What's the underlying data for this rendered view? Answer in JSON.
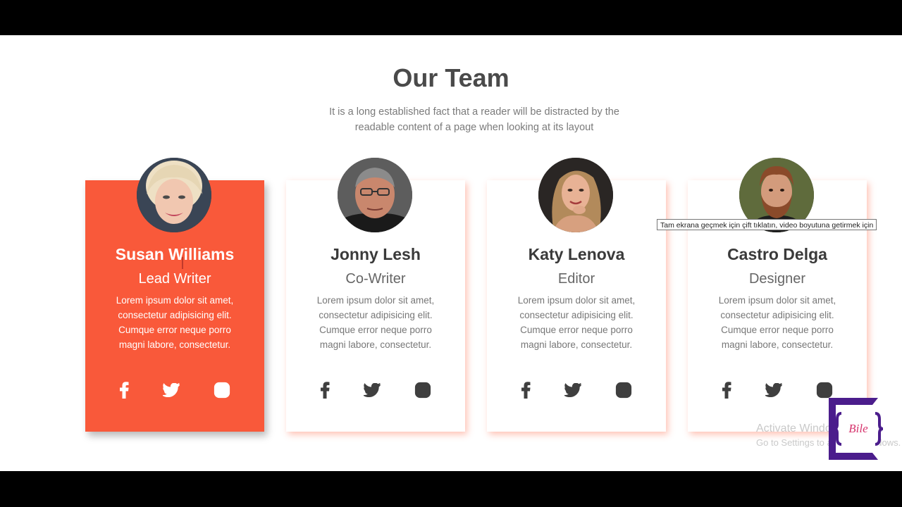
{
  "header": {
    "title": "Our Team",
    "subtitle": "It is a long established fact that a reader will be distracted by the readable content of a page when looking at its layout"
  },
  "team": [
    {
      "name": "Susan Williams",
      "role": "Lead Writer",
      "description": "Lorem ipsum dolor sit amet, consectetur adipisicing elit. Cumque error neque porro magni labore, consectetur."
    },
    {
      "name": "Jonny Lesh",
      "role": "Co-Writer",
      "description": "Lorem ipsum dolor sit amet, consectetur adipisicing elit. Cumque error neque porro magni labore, consectetur."
    },
    {
      "name": "Katy Lenova",
      "role": "Editor",
      "description": "Lorem ipsum dolor sit amet, consectetur adipisicing elit. Cumque error neque porro magni labore, consectetur."
    },
    {
      "name": "Castro Delga",
      "role": "Designer",
      "description": "Lorem ipsum dolor sit amet, consectetur adipisicing elit. Cumque error neque porro magni labore, consectetur."
    }
  ],
  "social_icons": [
    "facebook-icon",
    "twitter-icon",
    "instagram-icon"
  ],
  "tooltip": "Tam ekrana geçmek için çift tıklatın, video boyutuna getirmek için",
  "watermark": {
    "title": "Activate Windows",
    "subtitle": "Go to Settings to activate Windows."
  },
  "logo": {
    "text": "Bile"
  },
  "colors": {
    "accent": "#f9593a",
    "logo_purple": "#4b1d8c",
    "text_dark": "#3a3a3a"
  }
}
